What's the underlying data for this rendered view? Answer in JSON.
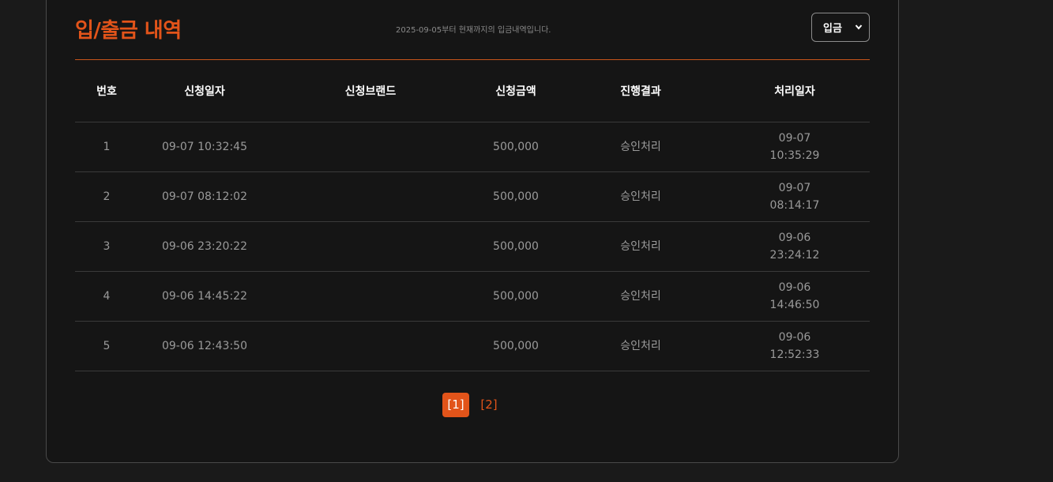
{
  "header": {
    "title": "입/출금 내역",
    "subtitle": "2025-09-05부터 현재까지의 입금내역입니다.",
    "type_select": {
      "selected": "입금"
    }
  },
  "table": {
    "columns": [
      "번호",
      "신청일자",
      "신청브랜드",
      "신청금액",
      "진행결과",
      "처리일자"
    ],
    "rows": [
      {
        "no": "1",
        "date": "09-07 10:32:45",
        "brand": "",
        "amount": "500,000",
        "result": "승인처리",
        "proc_date": "09-07",
        "proc_time": "10:35:29"
      },
      {
        "no": "2",
        "date": "09-07 08:12:02",
        "brand": "",
        "amount": "500,000",
        "result": "승인처리",
        "proc_date": "09-07",
        "proc_time": "08:14:17"
      },
      {
        "no": "3",
        "date": "09-06 23:20:22",
        "brand": "",
        "amount": "500,000",
        "result": "승인처리",
        "proc_date": "09-06",
        "proc_time": "23:24:12"
      },
      {
        "no": "4",
        "date": "09-06 14:45:22",
        "brand": "",
        "amount": "500,000",
        "result": "승인처리",
        "proc_date": "09-06",
        "proc_time": "14:46:50"
      },
      {
        "no": "5",
        "date": "09-06 12:43:50",
        "brand": "",
        "amount": "500,000",
        "result": "승인처리",
        "proc_date": "09-06",
        "proc_time": "12:52:33"
      }
    ]
  },
  "pagination": {
    "pages": [
      "[1]",
      "[2]"
    ],
    "active_index": 0
  },
  "colors": {
    "accent": "#e2541a",
    "background": "#151515",
    "page_background": "#1a1a1a",
    "text_muted": "#9a9a9a"
  }
}
